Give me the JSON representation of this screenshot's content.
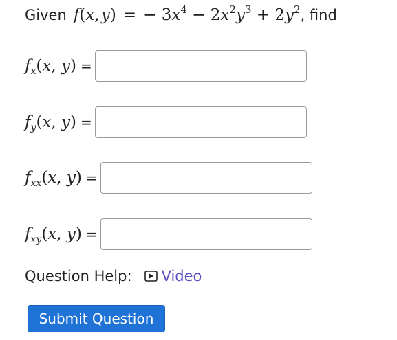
{
  "problem": {
    "intro": "Given",
    "function_lhs": "f(x, y)",
    "equals": "=",
    "expression": "− 3x⁴ − 2x²y³ + 2y²",
    "suffix": ", find"
  },
  "answers": [
    {
      "label": "fx(x, y)",
      "equals": "=",
      "value": "",
      "placeholder": ""
    },
    {
      "label": "fy(x, y)",
      "equals": "=",
      "value": "",
      "placeholder": ""
    },
    {
      "label": "fxx(x, y)",
      "equals": "=",
      "value": "",
      "placeholder": ""
    },
    {
      "label": "fxy(x, y)",
      "equals": "=",
      "value": "",
      "placeholder": ""
    }
  ],
  "help": {
    "label": "Question Help:",
    "video_link": "Video",
    "video_icon": "play-icon"
  },
  "submit_label": "Submit Question",
  "colors": {
    "link": "#5b4fc2",
    "submit_bg": "#1f73d6",
    "input_border": "#9a9a9a"
  }
}
